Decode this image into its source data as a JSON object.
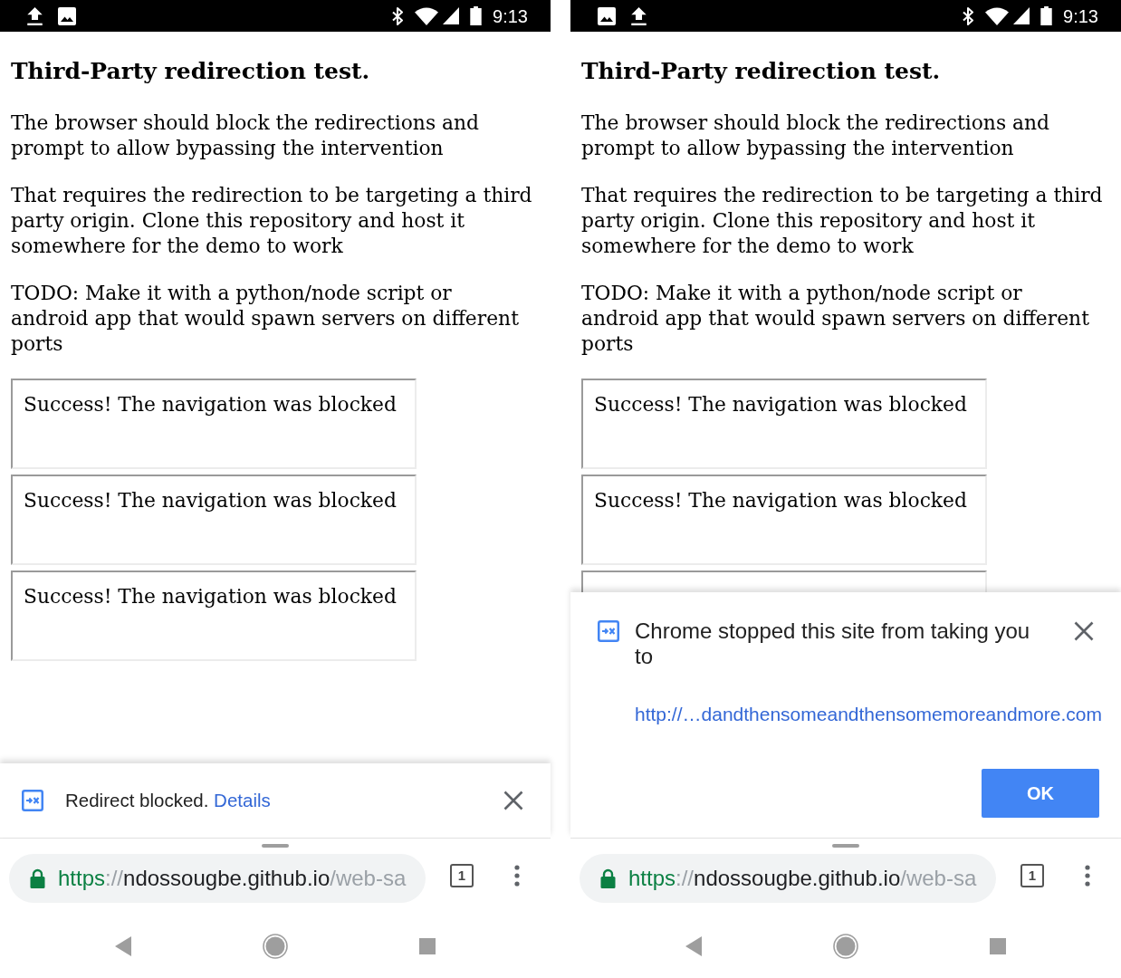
{
  "screens": [
    {
      "status_bar": {
        "notification_icons": [
          {
            "kind": "upload"
          },
          {
            "kind": "image"
          }
        ],
        "time": "9:13"
      },
      "page": {
        "title": "Third-Party redirection test.",
        "paragraphs": [
          "The browser should block the redirections and prompt to allow bypassing the intervention",
          "That requires the redirection to be targeting a third party origin. Clone this repository and host it somewhere for the demo to work",
          "TODO: Make it with a python/node script or android app that would spawn servers on different ports"
        ],
        "frames": [
          {
            "kind": "message",
            "text": "Success! The navigation was blocked"
          },
          {
            "kind": "message",
            "text": "Success! The navigation was blocked"
          },
          {
            "kind": "message",
            "text": "Success! The navigation was blocked"
          }
        ]
      },
      "infobar": {
        "kind": "compact",
        "message": "Redirect blocked.",
        "link": "Details"
      },
      "toolbar": {
        "url": {
          "scheme": "https",
          "separator": "://",
          "host": "ndossougbe.github.io",
          "path": "/web-sa"
        },
        "tab_count": "1"
      }
    },
    {
      "status_bar": {
        "notification_icons": [
          {
            "kind": "image"
          },
          {
            "kind": "upload"
          }
        ],
        "time": "9:13"
      },
      "page": {
        "title": "Third-Party redirection test.",
        "paragraphs": [
          "The browser should block the redirections and prompt to allow bypassing the intervention",
          "That requires the redirection to be targeting a third party origin. Clone this repository and host it somewhere for the demo to work",
          "TODO: Make it with a python/node script or android app that would spawn servers on different ports"
        ],
        "frames": [
          {
            "kind": "message",
            "text": "Success! The navigation was blocked"
          },
          {
            "kind": "message",
            "text": "Success! The navigation was blocked"
          },
          {
            "kind": "covered"
          }
        ]
      },
      "infobar": {
        "kind": "expanded",
        "message": "Chrome stopped this site from taking you to",
        "link": "http://…dandthensomeandthensomemoreandmore.com",
        "button": "OK"
      },
      "toolbar": {
        "url": {
          "scheme": "https",
          "separator": "://",
          "host": "ndossougbe.github.io",
          "path": "/web-sa"
        },
        "tab_count": "1"
      }
    }
  ]
}
